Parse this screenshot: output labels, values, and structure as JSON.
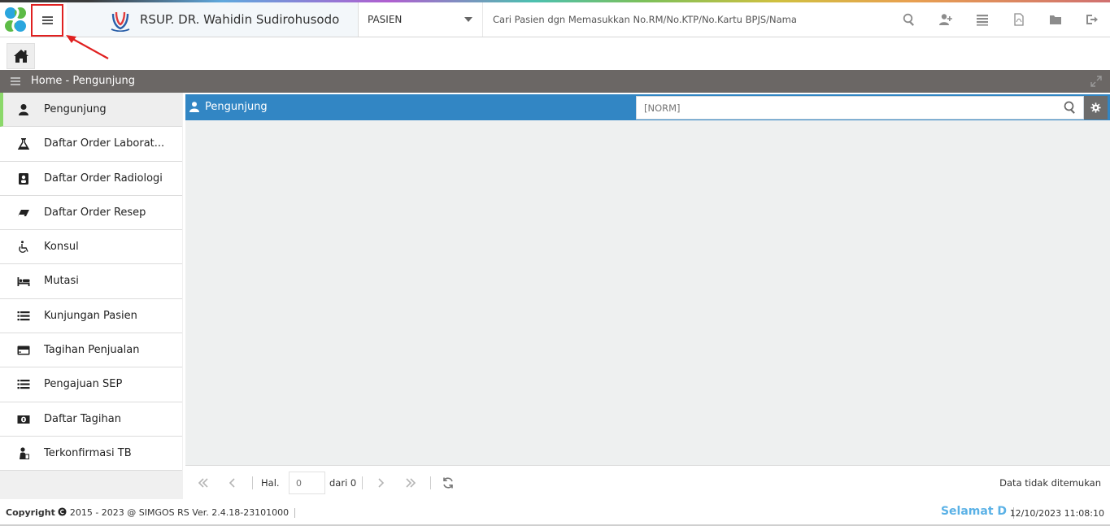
{
  "header": {
    "brand_name": "RSUP. DR. Wahidin Sudirohusodo",
    "category_selected": "PASIEN",
    "search_placeholder": "Cari Pasien dgn Memasukkan No.RM/No.KTP/No.Kartu BPJS/Nama",
    "tools": [
      "search-icon",
      "add-user-icon",
      "list-icon",
      "pdf-icon",
      "folder-icon",
      "logout-icon"
    ]
  },
  "breadcrumb": {
    "text": "Home - Pengunjung"
  },
  "sidebar": {
    "items": [
      {
        "label": "Pengunjung",
        "icon": "user-icon",
        "active": true
      },
      {
        "label": "Daftar Order Laborat...",
        "icon": "flask-icon"
      },
      {
        "label": "Daftar Order Radiologi",
        "icon": "radiology-icon"
      },
      {
        "label": "Daftar Order Resep",
        "icon": "eraser-icon"
      },
      {
        "label": "Konsul",
        "icon": "wheelchair-icon"
      },
      {
        "label": "Mutasi",
        "icon": "bed-icon"
      },
      {
        "label": "Kunjungan Pasien",
        "icon": "list-icon"
      },
      {
        "label": "Tagihan Penjualan",
        "icon": "credit-card-icon"
      },
      {
        "label": "Pengajuan SEP",
        "icon": "list-icon"
      },
      {
        "label": "Daftar Tagihan",
        "icon": "money-icon"
      },
      {
        "label": "Terkonfirmasi TB",
        "icon": "patient-icon"
      }
    ]
  },
  "panel": {
    "title": "Pengunjung",
    "norm_placeholder": "[NORM]"
  },
  "pager": {
    "hal_label": "Hal.",
    "page_value": "0",
    "of_label": "dari 0",
    "status": "Data tidak ditemukan"
  },
  "footer": {
    "copyright_label": "Copyright",
    "copyright_text": "2015 - 2023 @ SIMGOS RS Ver. 2.4.18-23101000",
    "welcome": "Selamat D",
    "datetime": "12/10/2023 11:08:10"
  },
  "colors": {
    "panel_header": "#3286c4",
    "breadcrumb_bar": "#6b6765",
    "active_marker": "#8bd86a",
    "welcome_text": "#5ab1e6",
    "highlight_box": "#e02020"
  }
}
